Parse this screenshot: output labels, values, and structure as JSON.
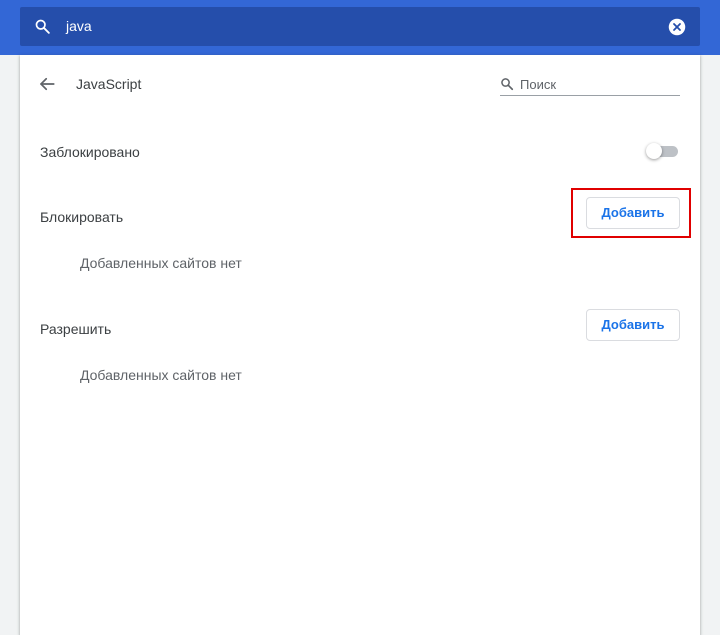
{
  "search": {
    "query": "java",
    "icon": "search-icon",
    "clear_icon": "clear-icon"
  },
  "header": {
    "back_icon": "back-arrow-icon",
    "title": "JavaScript",
    "search_placeholder": "Поиск"
  },
  "toggle_row": {
    "label": "Заблокировано",
    "enabled": false
  },
  "block_section": {
    "label": "Блокировать",
    "add_label": "Добавить",
    "empty_text": "Добавленных сайтов нет"
  },
  "allow_section": {
    "label": "Разрешить",
    "add_label": "Добавить",
    "empty_text": "Добавленных сайтов нет"
  },
  "colors": {
    "topbar": "#3367d6",
    "searchbox": "#254eab",
    "accent": "#1a73e8",
    "highlight": "#e00000"
  }
}
